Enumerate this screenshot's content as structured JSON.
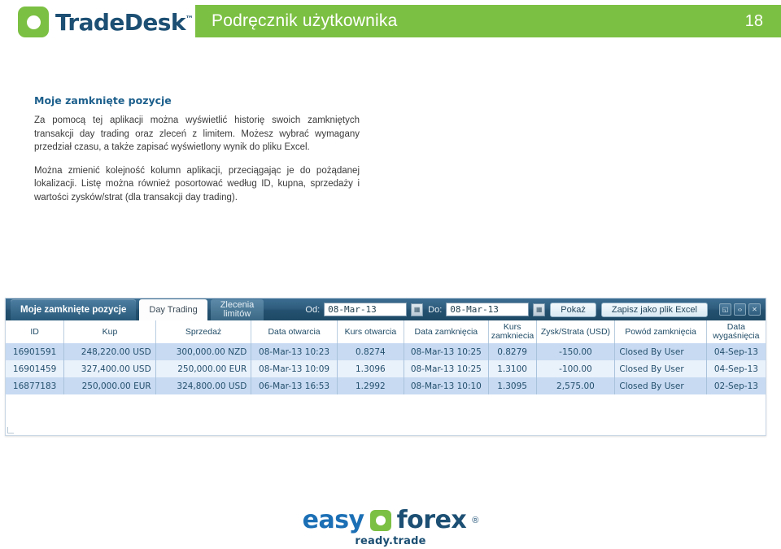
{
  "header": {
    "brand_name": "TradeDesk",
    "brand_tm": "™",
    "title": "Podręcznik użytkownika",
    "page_number": "18",
    "accent_green": "#7cc043",
    "brand_blue": "#1c4f73"
  },
  "content": {
    "section_title": "Moje zamknięte pozycje",
    "paragraph_1": "Za pomocą tej aplikacji można wyświetlić historię swoich zamkniętych transakcji day trading oraz zleceń z limitem. Możesz wybrać wymagany przedział czasu, a także zapisać wyświetlony wynik do pliku Excel.",
    "paragraph_2": "Można zmienić kolejność kolumn aplikacji, przeciągając je do pożądanej lokalizacji. Listę można również posortować według ID, kupna, sprzedaży i wartości zysków/strat (dla transakcji day trading)."
  },
  "app": {
    "tabs": [
      {
        "label": "Moje zamknięte pozycje",
        "state": "active"
      },
      {
        "label": "Day Trading",
        "state": "white"
      },
      {
        "label": "Zlecenia\nlimitów",
        "state": "dim"
      }
    ],
    "date_from_label": "Od:",
    "date_from_value": "08-Mar-13",
    "date_to_label": "Do:",
    "date_to_value": "08-Mar-13",
    "calendar_icon": "calendar-icon",
    "show_button": "Pokaż",
    "export_button": "Zapisz jako plik Excel",
    "window_buttons": [
      {
        "name": "restore-window-button",
        "glyph": "◱"
      },
      {
        "name": "collapse-window-button",
        "glyph": "‹›"
      },
      {
        "name": "close-window-button",
        "glyph": "✕"
      }
    ],
    "columns": [
      "ID",
      "Kup",
      "Sprzedaż",
      "Data otwarcia",
      "Kurs otwarcia",
      "Data zamknięcia",
      "Kurs\nzamkniecia",
      "Zysk/Strata (USD)",
      "Powód zamknięcia",
      "Data\nwygaśnięcia"
    ],
    "rows": [
      {
        "id": "16901591",
        "buy": "248,220.00 USD",
        "sell": "300,000.00 NZD",
        "open_date": "08-Mar-13 10:23",
        "open_rate": "0.8274",
        "close_date": "08-Mar-13 10:25",
        "close_rate": "0.8279",
        "pnl": "-150.00",
        "reason": "Closed By User",
        "expiry": "04-Sep-13"
      },
      {
        "id": "16901459",
        "buy": "327,400.00 USD",
        "sell": "250,000.00 EUR",
        "open_date": "08-Mar-13 10:09",
        "open_rate": "1.3096",
        "close_date": "08-Mar-13 10:25",
        "close_rate": "1.3100",
        "pnl": "-100.00",
        "reason": "Closed By User",
        "expiry": "04-Sep-13"
      },
      {
        "id": "16877183",
        "buy": "250,000.00 EUR",
        "sell": "324,800.00 USD",
        "open_date": "06-Mar-13 16:53",
        "open_rate": "1.2992",
        "close_date": "08-Mar-13 10:10",
        "close_rate": "1.3095",
        "pnl": "2,575.00",
        "reason": "Closed By User",
        "expiry": "02-Sep-13"
      }
    ]
  },
  "footer": {
    "word_easy": "easy",
    "word_forex": "forex",
    "registered_mark": "®",
    "tagline": "ready.trade"
  }
}
